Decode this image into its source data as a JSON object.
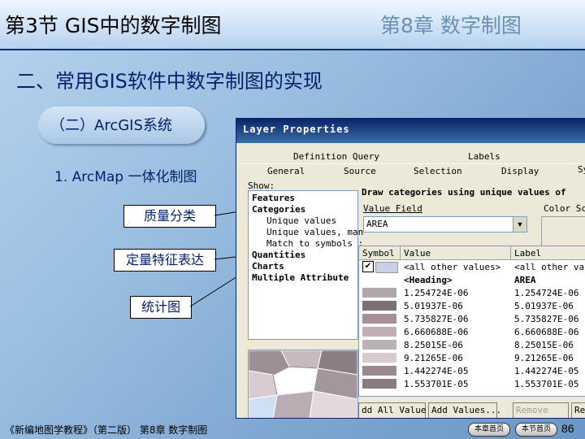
{
  "header": {
    "section_title": "第3节 GIS中的数字制图",
    "chapter_title": "第8章 数字制图"
  },
  "subtitle": "二、常用GIS软件中数字制图的实现",
  "section_pill": "（二）ArcGIS系统",
  "bullet_1": "1. ArcMap 一体化制图",
  "boxes": [
    "质量分类",
    "定量特征表达",
    "统计图"
  ],
  "dialog": {
    "title": "Layer Properties",
    "tabs_row1": [
      "Definition Query",
      "Labels"
    ],
    "tabs_row2": [
      "General",
      "Source",
      "Selection",
      "Display",
      "Sy"
    ],
    "show_label": "Show:",
    "show_items": [
      "Features",
      "Categories",
      "Unique values",
      "Unique values, man",
      "Match to symbols :",
      "Quantities",
      "Charts",
      "Multiple Attribute"
    ],
    "draw_text": "Draw categories using unique values of",
    "value_field_label": "Value Field",
    "value_field_value": "AREA",
    "color_scheme_label": "Color Sch",
    "table": {
      "headers": [
        "Symbol",
        "Value",
        "Label"
      ],
      "rows": [
        {
          "value": "<all other values>",
          "label": "<all other valu",
          "color": "#c8d0e8"
        },
        {
          "value": "<Heading>",
          "label": "AREA",
          "color": ""
        },
        {
          "value": "1.254724E-06",
          "label": "1.254724E-06",
          "color": "#b2a7ac"
        },
        {
          "value": "5.01937E-06",
          "label": "5.01937E-06",
          "color": "#7d6f76"
        },
        {
          "value": "5.735827E-06",
          "label": "5.735827E-06",
          "color": "#a78f98"
        },
        {
          "value": "6.660688E-06",
          "label": "6.660688E-06",
          "color": "#c3aeb5"
        },
        {
          "value": "8.25015E-06",
          "label": "8.25015E-06",
          "color": "#b9b3b3"
        },
        {
          "value": "9.21265E-06",
          "label": "9.21265E-06",
          "color": "#d8ccce"
        },
        {
          "value": "1.442274E-05",
          "label": "1.442274E-05",
          "color": "#9b8b90"
        },
        {
          "value": "1.553701E-05",
          "label": "1.553701E-05",
          "color": "#8a7c82"
        }
      ]
    },
    "buttons": [
      "dd All Value",
      "Add Values...",
      "Remove",
      "Re"
    ]
  },
  "footer": {
    "book": "《新编地图学教程》（第二版） 第8章 数字制图",
    "chapter_home": "本章首页",
    "section_home": "本节首页",
    "page": "86"
  }
}
